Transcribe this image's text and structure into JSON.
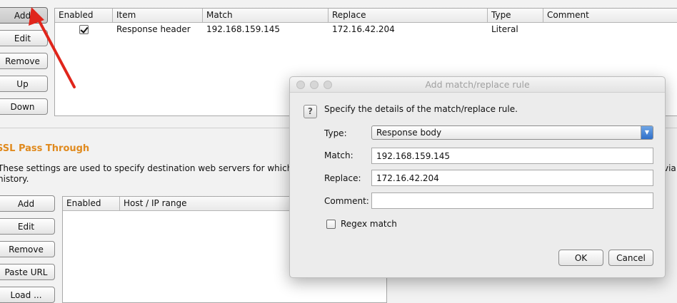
{
  "left_buttons": {
    "add": "Add",
    "edit": "Edit",
    "remove": "Remove",
    "up": "Up",
    "down": "Down"
  },
  "match_table": {
    "columns": [
      "Enabled",
      "Item",
      "Match",
      "Replace",
      "Type",
      "Comment"
    ],
    "rows": [
      {
        "enabled": true,
        "item": "Response header",
        "match": "192.168.159.145",
        "replace": "172.16.42.204",
        "type": "Literal",
        "comment": ""
      }
    ]
  },
  "ssl_section": {
    "title": "SSL Pass Through",
    "description_line1": "These settings are used to specify destination web servers for which Bu",
    "description_line1_end": "via",
    "description_line2": "history.",
    "buttons": {
      "add": "Add",
      "edit": "Edit",
      "remove": "Remove",
      "paste_url": "Paste URL",
      "load": "Load ..."
    },
    "columns": [
      "Enabled",
      "Host / IP range"
    ]
  },
  "dialog": {
    "title": "Add match/replace rule",
    "prompt": "Specify the details of the match/replace rule.",
    "help_icon_glyph": "?",
    "type_label": "Type:",
    "type_value": "Response body",
    "match_label": "Match:",
    "match_value": "192.168.159.145",
    "replace_label": "Replace:",
    "replace_value": "172.16.42.204",
    "comment_label": "Comment:",
    "comment_value": "",
    "regex_label": "Regex match",
    "regex_checked": false,
    "ok": "OK",
    "cancel": "Cancel"
  },
  "colors": {
    "section_title": "#e08a1e",
    "annotation_arrow": "#e0251b",
    "select_accent": "#2f6fc9"
  }
}
